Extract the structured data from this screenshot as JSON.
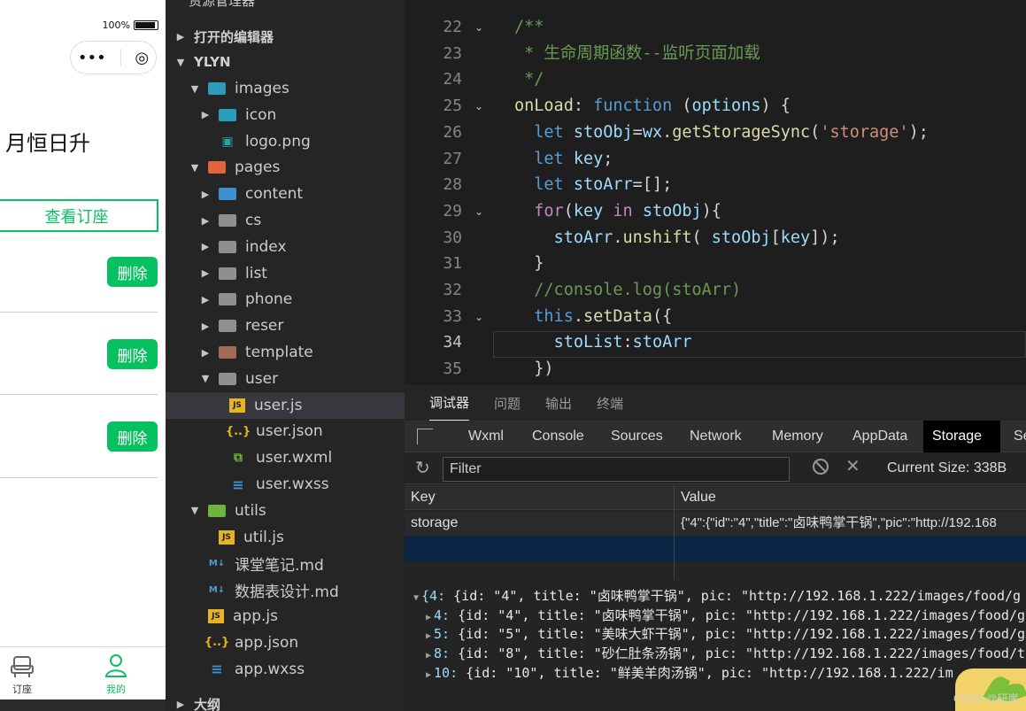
{
  "simulator": {
    "status": {
      "battery": "100%"
    },
    "capsule": {
      "more": "•••",
      "close": "◎"
    },
    "page_title": "月恒日升",
    "view_button": "查看订座",
    "delete_label": "删除",
    "tabs": [
      {
        "label": "订座",
        "icon": "seat-icon"
      },
      {
        "label": "我的",
        "icon": "user-icon"
      }
    ],
    "colors": {
      "accent": "#07c160"
    }
  },
  "explorer": {
    "title": "资源管理器",
    "more": "···",
    "sections": {
      "open_editors": "打开的编辑器",
      "outline": "大纲"
    },
    "root": "YLYN",
    "items": [
      {
        "label": "images",
        "icon": "folder-images-icon",
        "kind": "folder-img",
        "arrow": "▼"
      },
      {
        "label": "icon",
        "icon": "folder-icon",
        "kind": "folder-img",
        "arrow": "▶"
      },
      {
        "label": "logo.png",
        "icon": "image-file-icon",
        "kind": "png",
        "arrow": ""
      },
      {
        "label": "pages",
        "icon": "folder-pages-icon",
        "kind": "folder-red",
        "arrow": "▼"
      },
      {
        "label": "content",
        "icon": "folder-icon",
        "kind": "folder-blue",
        "arrow": "▶"
      },
      {
        "label": "cs",
        "icon": "folder-icon",
        "kind": "folder",
        "arrow": "▶"
      },
      {
        "label": "index",
        "icon": "folder-icon",
        "kind": "folder",
        "arrow": "▶"
      },
      {
        "label": "list",
        "icon": "folder-icon",
        "kind": "folder",
        "arrow": "▶"
      },
      {
        "label": "phone",
        "icon": "folder-icon",
        "kind": "folder",
        "arrow": "▶"
      },
      {
        "label": "reser",
        "icon": "folder-icon",
        "kind": "folder",
        "arrow": "▶"
      },
      {
        "label": "template",
        "icon": "folder-template-icon",
        "kind": "folder-tpl",
        "arrow": "▶"
      },
      {
        "label": "user",
        "icon": "folder-open-icon",
        "kind": "folder",
        "arrow": "▼"
      },
      {
        "label": "user.js",
        "icon": "js-file-icon",
        "kind": "js",
        "arrow": "",
        "selected": true
      },
      {
        "label": "user.json",
        "icon": "json-file-icon",
        "kind": "json",
        "arrow": ""
      },
      {
        "label": "user.wxml",
        "icon": "wxml-file-icon",
        "kind": "wxml",
        "arrow": ""
      },
      {
        "label": "user.wxss",
        "icon": "wxss-file-icon",
        "kind": "wxss",
        "arrow": ""
      },
      {
        "label": "utils",
        "icon": "folder-utils-icon",
        "kind": "folder-green",
        "arrow": "▼"
      },
      {
        "label": "util.js",
        "icon": "js-file-icon",
        "kind": "js",
        "arrow": ""
      },
      {
        "label": "课堂笔记.md",
        "icon": "markdown-file-icon",
        "kind": "md",
        "arrow": ""
      },
      {
        "label": "数据表设计.md",
        "icon": "markdown-file-icon",
        "kind": "md",
        "arrow": ""
      },
      {
        "label": "app.js",
        "icon": "js-file-icon",
        "kind": "js",
        "arrow": ""
      },
      {
        "label": "app.json",
        "icon": "json-file-icon",
        "kind": "json",
        "arrow": ""
      },
      {
        "label": "app.wxss",
        "icon": "wxss-file-icon",
        "kind": "wxss",
        "arrow": ""
      }
    ]
  },
  "editor": {
    "active_line": 34,
    "lines": [
      {
        "n": 22,
        "fold": "⌄",
        "code": "/**"
      },
      {
        "n": 23,
        "fold": "",
        "code": " * 生命周期函数--监听页面加载"
      },
      {
        "n": 24,
        "fold": "",
        "code": " */"
      },
      {
        "n": 25,
        "fold": "⌄",
        "code": "onLoad: function (options) {"
      },
      {
        "n": 26,
        "fold": "",
        "code": "  let stoObj=wx.getStorageSync('storage');"
      },
      {
        "n": 27,
        "fold": "",
        "code": "  let key;"
      },
      {
        "n": 28,
        "fold": "",
        "code": "  let stoArr=[];"
      },
      {
        "n": 29,
        "fold": "⌄",
        "code": "  for(key in stoObj){"
      },
      {
        "n": 30,
        "fold": "",
        "code": "    stoArr.unshift( stoObj[key]);"
      },
      {
        "n": 31,
        "fold": "",
        "code": "  }"
      },
      {
        "n": 32,
        "fold": "",
        "code": "  //console.log(stoArr)"
      },
      {
        "n": 33,
        "fold": "⌄",
        "code": "  this.setData({"
      },
      {
        "n": 34,
        "fold": "",
        "code": "    stoList:stoArr"
      },
      {
        "n": 35,
        "fold": "",
        "code": "  })"
      }
    ]
  },
  "devtools": {
    "panel_tabs": [
      "调试器",
      "问题",
      "输出",
      "终端"
    ],
    "active_panel_tab": "调试器",
    "tool_tabs": [
      "Wxml",
      "Console",
      "Sources",
      "Network",
      "Memory",
      "AppData",
      "Storage",
      "Se"
    ],
    "active_tool_tab": "Storage",
    "filter_placeholder": "Filter",
    "current_size": "Current Size: 338B",
    "table": {
      "headers": [
        "Key",
        "Value"
      ],
      "rows": [
        {
          "key": "storage",
          "value": "{\"4\":{\"id\":\"4\",\"title\":\"卤味鸭掌干锅\",\"pic\":\"http://192.168"
        }
      ]
    },
    "console_lines": [
      {
        "tri": "▼",
        "indent": 0,
        "key": "{4:",
        "text": " {id: \"4\", title: \"卤味鸭掌干锅\", pic: \"http://192.168.1.222/images/food/g"
      },
      {
        "tri": "▶",
        "indent": 1,
        "key": "4:",
        "text": " {id: \"4\", title: \"卤味鸭掌干锅\", pic: \"http://192.168.1.222/images/food/g"
      },
      {
        "tri": "▶",
        "indent": 1,
        "key": "5:",
        "text": " {id: \"5\", title: \"美味大虾干锅\", pic: \"http://192.168.1.222/images/food/g"
      },
      {
        "tri": "▶",
        "indent": 1,
        "key": "8:",
        "text": " {id: \"8\", title: \"砂仁肚条汤锅\", pic: \"http://192.168.1.222/images/food/t"
      },
      {
        "tri": "▶",
        "indent": 1,
        "key": "10:",
        "text": " {id: \"10\", title: \"鲜美羊肉汤锅\", pic: \"http://192.168.1.222/im"
      }
    ],
    "watermark": "CSDN @研崖"
  }
}
